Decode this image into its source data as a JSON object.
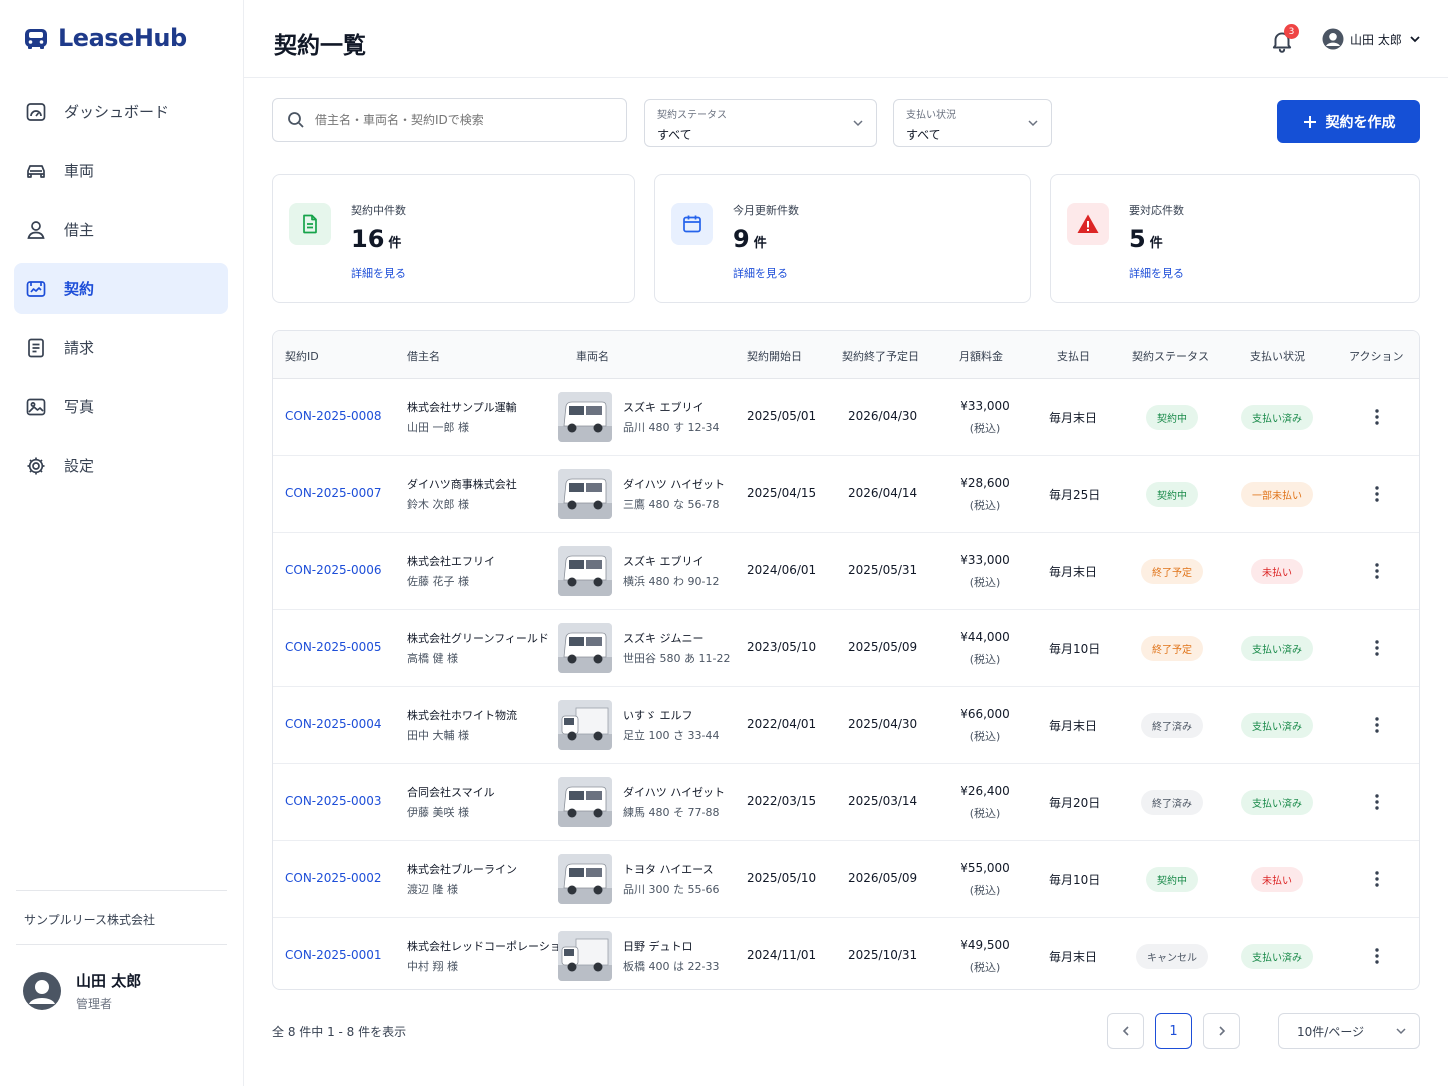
{
  "app": {
    "name": "LeaseHub"
  },
  "sidebar": {
    "items": [
      {
        "label": "ダッシュボード",
        "icon": "dashboard-icon"
      },
      {
        "label": "車両",
        "icon": "car-icon"
      },
      {
        "label": "借主",
        "icon": "person-icon"
      },
      {
        "label": "契約",
        "icon": "contract-icon",
        "active": true
      },
      {
        "label": "請求",
        "icon": "invoice-icon"
      },
      {
        "label": "写真",
        "icon": "photo-icon"
      },
      {
        "label": "設定",
        "icon": "gear-icon"
      }
    ],
    "company": "サンプルリース株式会社",
    "user": {
      "name": "山田 太郎",
      "role": "管理者"
    }
  },
  "header": {
    "title": "契約一覧",
    "notification_count": "3",
    "user_name": "山田 太郎"
  },
  "filters": {
    "search_placeholder": "借主名・車両名・契約IDで検索",
    "status": {
      "label": "契約ステータス",
      "value": "すべて"
    },
    "payment": {
      "label": "支払い状況",
      "value": "すべて"
    },
    "create_label": "契約を作成"
  },
  "stats": [
    {
      "label": "契約中件数",
      "value": "16",
      "unit": "件",
      "link": "詳細を見る",
      "icon": "document-icon",
      "color": "#16a34a"
    },
    {
      "label": "今月更新件数",
      "value": "9",
      "unit": "件",
      "link": "詳細を見る",
      "icon": "calendar-icon",
      "color": "#2563eb"
    },
    {
      "label": "要対応件数",
      "value": "5",
      "unit": "件",
      "link": "詳細を見る",
      "icon": "warning-icon",
      "color": "#dc2626"
    }
  ],
  "table": {
    "headers": [
      "契約ID",
      "借主名",
      "車両名",
      "契約開始日",
      "契約終了予定日",
      "月額料金",
      "支払日",
      "契約ステータス",
      "支払い状況",
      "アクション"
    ],
    "rows": [
      {
        "id": "CON-2025-0008",
        "company": "株式会社サンプル運輸",
        "person": "山田 一郎 様",
        "vehicle": "スズキ エブリイ",
        "plate": "品川 480 す 12-34",
        "start": "2025/05/01",
        "end": "2026/04/30",
        "fee": "¥33,000",
        "tax": "(税込)",
        "payday": "毎月末日",
        "status": "契約中",
        "status_type": "green",
        "payment": "支払い済み",
        "payment_type": "green"
      },
      {
        "id": "CON-2025-0007",
        "company": "ダイハツ商事株式会社",
        "person": "鈴木 次郎 様",
        "vehicle": "ダイハツ ハイゼット",
        "plate": "三鷹 480 な 56-78",
        "start": "2025/04/15",
        "end": "2026/04/14",
        "fee": "¥28,600",
        "tax": "(税込)",
        "payday": "毎月25日",
        "status": "契約中",
        "status_type": "green",
        "payment": "一部未払い",
        "payment_type": "orange"
      },
      {
        "id": "CON-2025-0006",
        "company": "株式会社エフリイ",
        "person": "佐藤 花子 様",
        "vehicle": "スズキ エブリイ",
        "plate": "横浜 480 わ 90-12",
        "start": "2024/06/01",
        "end": "2025/05/31",
        "fee": "¥33,000",
        "tax": "(税込)",
        "payday": "毎月末日",
        "status": "終了予定",
        "status_type": "orange",
        "payment": "未払い",
        "payment_type": "red"
      },
      {
        "id": "CON-2025-0005",
        "company": "株式会社グリーンフィールド",
        "person": "高橋 健 様",
        "vehicle": "スズキ ジムニー",
        "plate": "世田谷 580 あ 11-22",
        "start": "2023/05/10",
        "end": "2025/05/09",
        "fee": "¥44,000",
        "tax": "(税込)",
        "payday": "毎月10日",
        "status": "終了予定",
        "status_type": "orange",
        "payment": "支払い済み",
        "payment_type": "green"
      },
      {
        "id": "CON-2025-0004",
        "company": "株式会社ホワイト物流",
        "person": "田中 大輔 様",
        "vehicle": "いすゞ エルフ",
        "plate": "足立 100 さ 33-44",
        "start": "2022/04/01",
        "end": "2025/04/30",
        "fee": "¥66,000",
        "tax": "(税込)",
        "payday": "毎月末日",
        "status": "終了済み",
        "status_type": "gray",
        "payment": "支払い済み",
        "payment_type": "green"
      },
      {
        "id": "CON-2025-0003",
        "company": "合同会社スマイル",
        "person": "伊藤 美咲 様",
        "vehicle": "ダイハツ ハイゼット",
        "plate": "練馬 480 そ 77-88",
        "start": "2022/03/15",
        "end": "2025/03/14",
        "fee": "¥26,400",
        "tax": "(税込)",
        "payday": "毎月20日",
        "status": "終了済み",
        "status_type": "gray",
        "payment": "支払い済み",
        "payment_type": "green"
      },
      {
        "id": "CON-2025-0002",
        "company": "株式会社ブルーライン",
        "person": "渡辺 隆 様",
        "vehicle": "トヨタ ハイエース",
        "plate": "品川 300 た 55-66",
        "start": "2025/05/10",
        "end": "2026/05/09",
        "fee": "¥55,000",
        "tax": "(税込)",
        "payday": "毎月10日",
        "status": "契約中",
        "status_type": "green",
        "payment": "未払い",
        "payment_type": "red"
      },
      {
        "id": "CON-2025-0001",
        "company": "株式会社レッドコーポレーション",
        "person": "中村 翔 様",
        "vehicle": "日野 デュトロ",
        "plate": "板橋 400 は 22-33",
        "start": "2024/11/01",
        "end": "2025/10/31",
        "fee": "¥49,500",
        "tax": "(税込)",
        "payday": "毎月末日",
        "status": "キャンセル",
        "status_type": "gray",
        "payment": "支払い済み",
        "payment_type": "green"
      }
    ]
  },
  "footer": {
    "summary": "全 8 件中 1 - 8 件を表示",
    "current_page": "1",
    "page_size": "10件/ページ"
  },
  "colors": {
    "accent": "#1550d6",
    "link": "#1d4ed8"
  }
}
